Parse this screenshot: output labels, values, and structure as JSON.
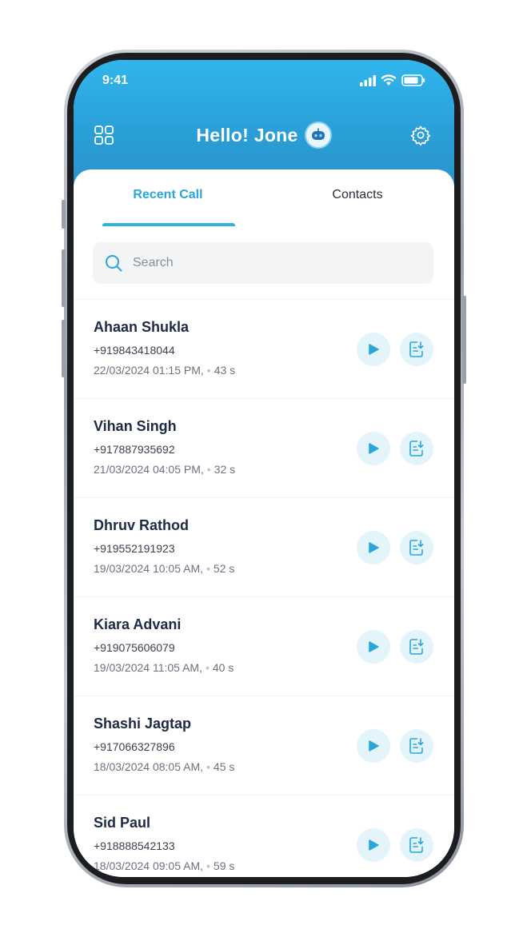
{
  "status_bar": {
    "time": "9:41"
  },
  "header": {
    "title": "Hello! Jone"
  },
  "tabs": [
    {
      "label": "Recent Call",
      "active": true
    },
    {
      "label": "Contacts",
      "active": false
    }
  ],
  "search": {
    "placeholder": "Search",
    "value": ""
  },
  "calls": [
    {
      "name": "Ahaan Shukla",
      "phone": "+919843418044",
      "datetime": "22/03/2024 01:15 PM,",
      "duration": "43 s"
    },
    {
      "name": "Vihan  Singh",
      "phone": "+917887935692",
      "datetime": "21/03/2024 04:05 PM,",
      "duration": "32 s"
    },
    {
      "name": "Dhruv Rathod",
      "phone": "+919552191923",
      "datetime": "19/03/2024 10:05 AM,",
      "duration": "52 s"
    },
    {
      "name": " Kiara Advani",
      "phone": "+919075606079",
      "datetime": "19/03/2024 11:05 AM,",
      "duration": "40 s"
    },
    {
      "name": "Shashi  Jagtap",
      "phone": "+917066327896",
      "datetime": "18/03/2024 08:05 AM,",
      "duration": "45 s"
    },
    {
      "name": "Sid  Paul",
      "phone": "+918888542133",
      "datetime": "18/03/2024 09:05 AM,",
      "duration": "59 s"
    }
  ],
  "colors": {
    "accent": "#2aa6dc",
    "header_top": "#2fb6ec",
    "header_bottom": "#2a92c9",
    "action_bg": "#e4f4fb"
  }
}
